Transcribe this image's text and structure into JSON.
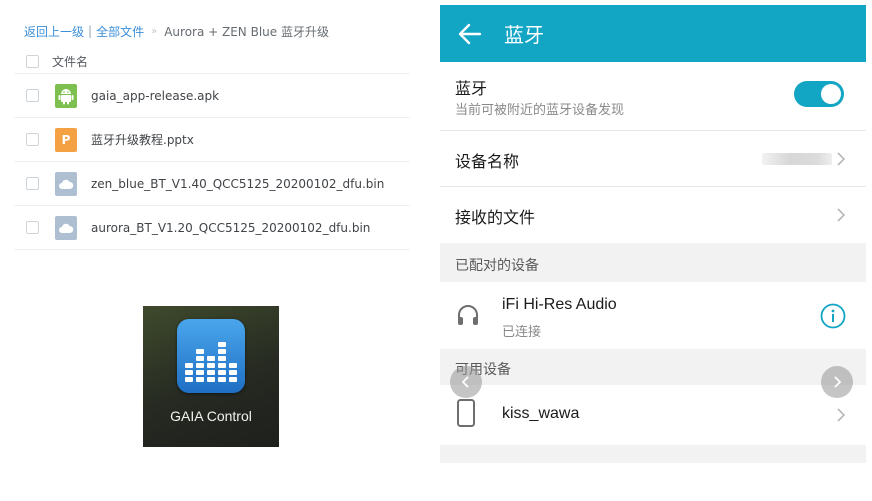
{
  "breadcrumb": {
    "back": "返回上一级",
    "separator": "|",
    "all_files": "全部文件",
    "chevron": "»",
    "current": "Aurora + ZEN Blue 蓝牙升级"
  },
  "file_list": {
    "header": "文件名",
    "files": [
      {
        "name": "gaia_app-release.apk",
        "icon": "android-icon"
      },
      {
        "name": "蓝牙升级教程.pptx",
        "icon": "ppt-icon",
        "badge": "P"
      },
      {
        "name": "zen_blue_BT_V1.40_QCC5125_20200102_dfu.bin",
        "icon": "cloud-file-icon"
      },
      {
        "name": "aurora_BT_V1.20_QCC5125_20200102_dfu.bin",
        "icon": "cloud-file-icon"
      }
    ]
  },
  "app_icon": {
    "label": "GAIA Control",
    "icon": "equalizer-icon"
  },
  "phone": {
    "title": "蓝牙",
    "accent_color": "#12a5c4",
    "bluetooth": {
      "label": "蓝牙",
      "sublabel": "当前可被附近的蓝牙设备发现",
      "enabled": true
    },
    "device_name": {
      "label": "设备名称",
      "value": ""
    },
    "received_files": {
      "label": "接收的文件"
    },
    "paired_header": "已配对的设备",
    "paired": [
      {
        "name": "iFi Hi-Res Audio",
        "status": "已连接",
        "icon": "headphones-icon"
      }
    ],
    "available_header": "可用设备",
    "available": [
      {
        "name": "kiss_wawa",
        "icon": "phone-icon"
      }
    ]
  }
}
